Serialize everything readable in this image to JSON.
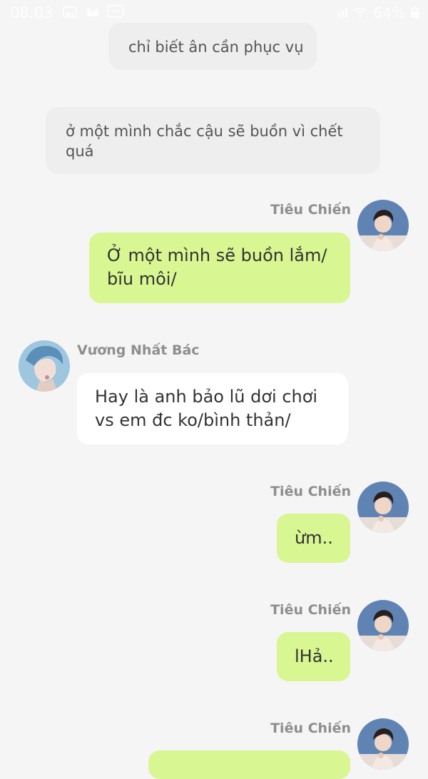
{
  "status_bar": {
    "time": "08:03",
    "battery": "64%",
    "icons": [
      "image-icon",
      "cat-icon",
      "message-icon",
      "signal-icon",
      "wifi-icon",
      "lock-icon"
    ]
  },
  "messages": [
    {
      "kind": "narration",
      "text": "chỉ biết ân cần phục vụ"
    },
    {
      "kind": "narration",
      "text": "ở một mình chắc cậu sẽ buồn vì chết quá"
    },
    {
      "kind": "bubble",
      "side": "right",
      "sender": "Tiêu Chiến",
      "text": "Ở một mình sẽ buồn lắm/ bĩu môi/"
    },
    {
      "kind": "bubble",
      "side": "left",
      "sender": "Vương Nhất Bác",
      "text": "Hay là anh bảo lũ dơi chơi vs em đc ko/bình thản/"
    },
    {
      "kind": "bubble",
      "side": "right",
      "sender": "Tiêu Chiến",
      "text": "ừm.."
    },
    {
      "kind": "bubble",
      "side": "right",
      "sender": "Tiêu Chiến",
      "text": "lHả.."
    },
    {
      "kind": "bubble",
      "side": "right",
      "sender": "Tiêu Chiến",
      "text": ""
    }
  ],
  "colors": {
    "background": "#f5f5f5",
    "my_bubble": "#d8f692",
    "their_bubble": "#ffffff",
    "narration_bubble": "#eeeeee",
    "sender_name": "#8e8e8e"
  }
}
